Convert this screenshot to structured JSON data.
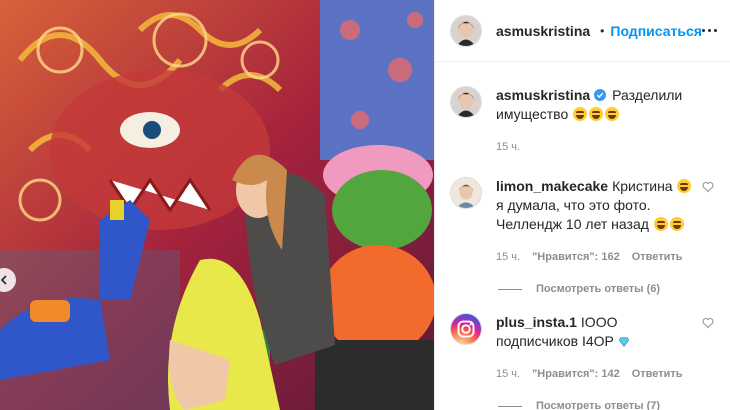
{
  "post": {
    "author": "asmuskristina",
    "follow_label": "Подписаться",
    "dot": "•"
  },
  "caption": {
    "user": "asmuskristina",
    "text": "Разделили имущество",
    "time": "15 ч."
  },
  "comments": [
    {
      "user": "limon_makecake",
      "text_a": "Кристина",
      "text_b": "я думала, что это фото. Челлендж 10 лет назад",
      "time": "15 ч.",
      "likes": "\"Нравится\": 162",
      "reply_label": "Ответить",
      "replies_label": "Посмотреть ответы (6)"
    },
    {
      "user": "plus_insta.1",
      "text": "IООО подписчиков I4ОР",
      "time": "15 ч.",
      "likes": "\"Нравится\": 142",
      "reply_label": "Ответить",
      "replies_label": "Посмотреть ответы (7)"
    }
  ],
  "colors": {
    "link_blue": "#0095f6",
    "verified_blue": "#3897f0",
    "muted": "#8e8e8e"
  }
}
